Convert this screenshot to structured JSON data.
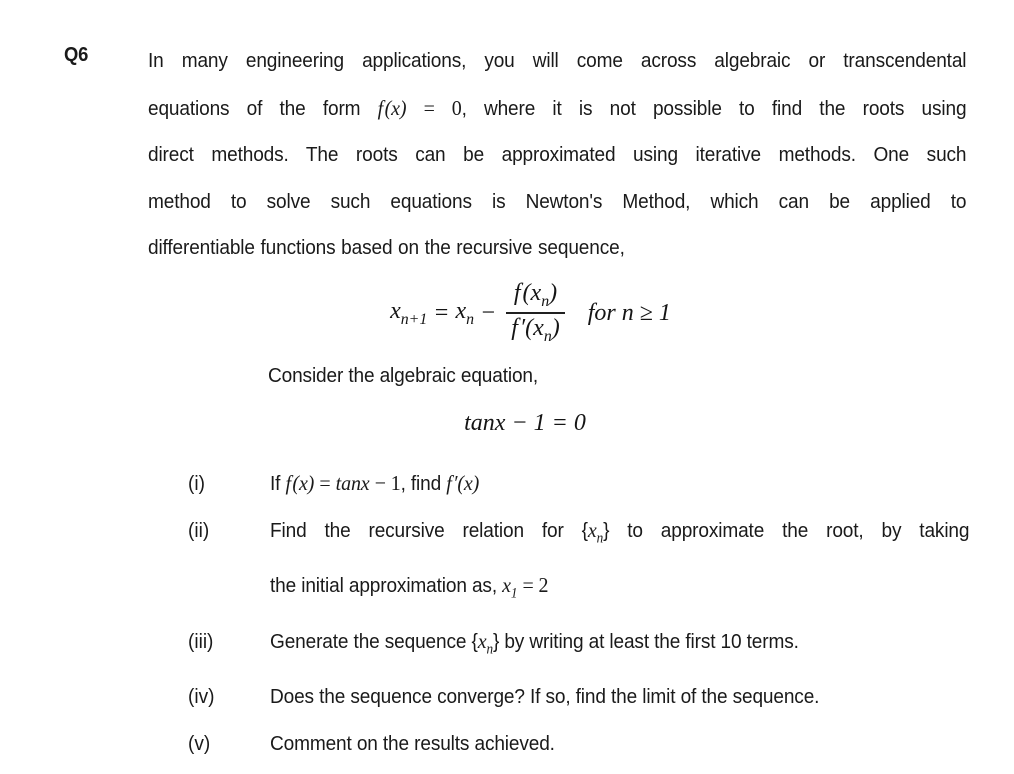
{
  "document": {
    "question_label": "Q6",
    "intro_paragraph": "In many engineering applications, you will come across algebraic or transcendental equations of the form f(x) = 0, where it is not possible to find the roots using direct methods. The roots can be approximated using iterative methods. One such method to solve such equations is Newton's Method, which can be applied to differentiable functions based on the recursive sequence,",
    "intro_lines": [
      "In many engineering applications, you will come across algebraic or transcendental",
      "equations of the form f(x) = 0, where it is not possible to find the roots using",
      "direct methods. The roots can be approximated using iterative methods. One such",
      "method to solve such equations is Newton's Method, which can be applied to",
      "differentiable functions based on the recursive sequence,"
    ],
    "newton_formula": {
      "lhs": "x",
      "lhs_sub": "n+1",
      "equals": "=",
      "term": "x",
      "term_sub": "n",
      "minus": "−",
      "numerator": "f(x",
      "numerator_sub": "n",
      "numerator_close": ")",
      "denominator": "f′(x",
      "denominator_sub": "n",
      "denominator_close": ")",
      "condition": "for n ≥ 1",
      "plain": "x_{n+1} = x_n − f(x_n)/f′(x_n)  for n ≥ 1"
    },
    "consider_text": "Consider the algebraic equation,",
    "main_equation": "tanx − 1 = 0",
    "items": [
      {
        "numeral": "(i)",
        "lines": [
          "If f(x) =  tanx − 1, find f′(x)"
        ],
        "plain": "If f(x) = tanx − 1, find f′(x)"
      },
      {
        "numeral": "(ii)",
        "lines": [
          "Find the recursive relation for {xₙ} to approximate the root, by taking",
          "the initial approximation as, x₁ = 2"
        ],
        "plain": "Find the recursive relation for {x_n} to approximate the root, by taking the initial approximation as, x_1 = 2"
      },
      {
        "numeral": "(iii)",
        "lines": [
          "Generate the sequence {xₙ} by writing at least the first 10 terms."
        ],
        "plain": "Generate the sequence {x_n} by writing at least the first 10 terms."
      },
      {
        "numeral": "(iv)",
        "lines": [
          "Does the sequence converge? If so, find the limit of the sequence."
        ],
        "plain": "Does the sequence converge? If so, find the limit of the sequence."
      },
      {
        "numeral": "(v)",
        "lines": [
          "Comment on the results achieved."
        ],
        "plain": "Comment on the results achieved."
      }
    ],
    "colors": {
      "page_background": "#ffffff",
      "body_text": "#1a1a1a",
      "math_text": "#151515"
    }
  }
}
